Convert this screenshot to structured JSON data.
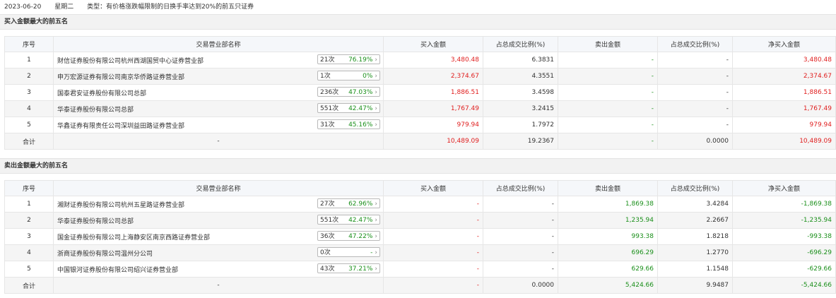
{
  "header": {
    "date": "2023-06-20",
    "weekday": "星期二",
    "type_text": "类型：有价格涨跌幅限制的日换手率达到20%的前五只证券"
  },
  "columns": [
    "序号",
    "交易营业部名称",
    "买入金额",
    "占总成交比例(%)",
    "卖出金额",
    "占总成交比例(%)",
    "净买入金额"
  ],
  "buy_section": {
    "title": "买入金额最大的前五名",
    "rows": [
      {
        "idx": "1",
        "name": "财信证券股份有限公司杭州西湖国贸中心证券营业部",
        "count": "21次",
        "pct": "76.19%",
        "buy": "3,480.48",
        "buy_ratio": "6.3831",
        "sell": "-",
        "sell_ratio": "-",
        "net": "3,480.48"
      },
      {
        "idx": "2",
        "name": "申万宏源证券有限公司南京华侨路证券营业部",
        "count": "1次",
        "pct": "0%",
        "buy": "2,374.67",
        "buy_ratio": "4.3551",
        "sell": "-",
        "sell_ratio": "-",
        "net": "2,374.67"
      },
      {
        "idx": "3",
        "name": "国泰君安证券股份有限公司总部",
        "count": "236次",
        "pct": "47.03%",
        "buy": "1,886.51",
        "buy_ratio": "3.4598",
        "sell": "-",
        "sell_ratio": "-",
        "net": "1,886.51"
      },
      {
        "idx": "4",
        "name": "华泰证券股份有限公司总部",
        "count": "551次",
        "pct": "42.47%",
        "buy": "1,767.49",
        "buy_ratio": "3.2415",
        "sell": "-",
        "sell_ratio": "-",
        "net": "1,767.49"
      },
      {
        "idx": "5",
        "name": "华鑫证券有限责任公司深圳益田路证券营业部",
        "count": "31次",
        "pct": "45.16%",
        "buy": "979.94",
        "buy_ratio": "1.7972",
        "sell": "-",
        "sell_ratio": "-",
        "net": "979.94"
      }
    ],
    "total": {
      "label": "合计",
      "name": "-",
      "buy": "10,489.09",
      "buy_ratio": "19.2367",
      "sell": "-",
      "sell_ratio": "0.0000",
      "net": "10,489.09"
    }
  },
  "sell_section": {
    "title": "卖出金额最大的前五名",
    "rows": [
      {
        "idx": "1",
        "name": "湘财证券股份有限公司杭州五星路证券营业部",
        "count": "27次",
        "pct": "62.96%",
        "buy": "-",
        "buy_ratio": "-",
        "sell": "1,869.38",
        "sell_ratio": "3.4284",
        "net": "-1,869.38"
      },
      {
        "idx": "2",
        "name": "华泰证券股份有限公司总部",
        "count": "551次",
        "pct": "42.47%",
        "buy": "-",
        "buy_ratio": "-",
        "sell": "1,235.94",
        "sell_ratio": "2.2667",
        "net": "-1,235.94"
      },
      {
        "idx": "3",
        "name": "国金证券股份有限公司上海静安区南京西路证券营业部",
        "count": "36次",
        "pct": "47.22%",
        "buy": "-",
        "buy_ratio": "-",
        "sell": "993.38",
        "sell_ratio": "1.8218",
        "net": "-993.38"
      },
      {
        "idx": "4",
        "name": "浙商证券股份有限公司温州分公司",
        "count": "0次",
        "pct": "-",
        "buy": "-",
        "buy_ratio": "-",
        "sell": "696.29",
        "sell_ratio": "1.2770",
        "net": "-696.29"
      },
      {
        "idx": "5",
        "name": "中国银河证券股份有限公司绍兴证券营业部",
        "count": "43次",
        "pct": "37.21%",
        "buy": "-",
        "buy_ratio": "-",
        "sell": "629.66",
        "sell_ratio": "1.1548",
        "net": "-629.66"
      }
    ],
    "total": {
      "label": "合计",
      "name": "-",
      "buy": "-",
      "buy_ratio": "0.0000",
      "sell": "5,424.66",
      "sell_ratio": "9.9487",
      "net": "-5,424.66"
    }
  },
  "pill_arrow": "›"
}
